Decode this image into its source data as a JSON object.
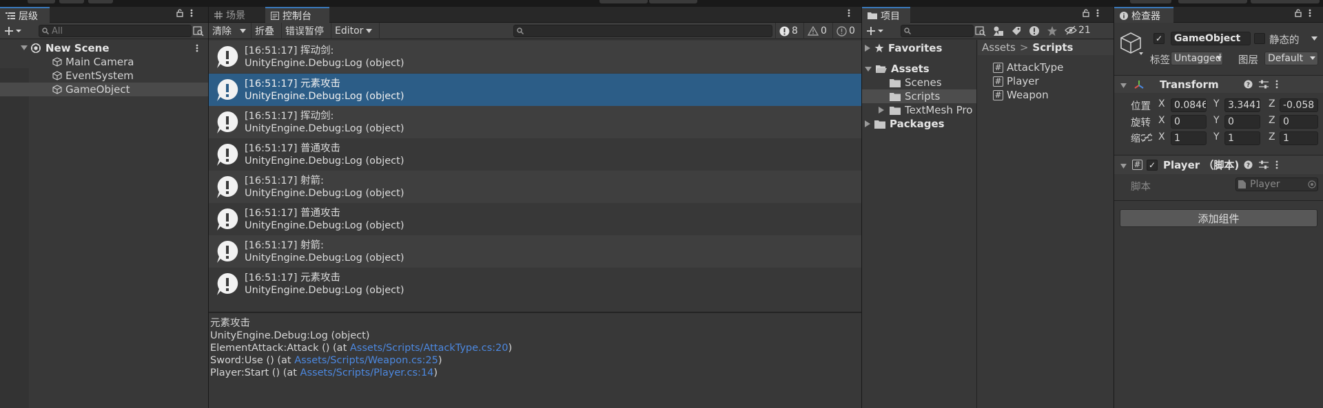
{
  "hierarchy": {
    "tab_label": "层级",
    "search_placeholder": "All",
    "scene": "New Scene",
    "items": [
      "Main Camera",
      "EventSystem",
      "GameObject"
    ]
  },
  "console": {
    "tabs": [
      "场景",
      "控制台"
    ],
    "toolbar": {
      "clear": "清除",
      "collapse": "折叠",
      "error_pause": "错误暂停",
      "editor": "Editor",
      "counts": {
        "info": "8",
        "warn": "0",
        "error": "0"
      }
    },
    "logs": [
      {
        "time": "[16:51:17] 挥动剑:",
        "trace": "UnityEngine.Debug:Log (object)"
      },
      {
        "time": "[16:51:17] 元素攻击",
        "trace": "UnityEngine.Debug:Log (object)"
      },
      {
        "time": "[16:51:17] 挥动剑:",
        "trace": "UnityEngine.Debug:Log (object)"
      },
      {
        "time": "[16:51:17] 普通攻击",
        "trace": "UnityEngine.Debug:Log (object)"
      },
      {
        "time": "[16:51:17] 射箭:",
        "trace": "UnityEngine.Debug:Log (object)"
      },
      {
        "time": "[16:51:17] 普通攻击",
        "trace": "UnityEngine.Debug:Log (object)"
      },
      {
        "time": "[16:51:17] 射箭:",
        "trace": "UnityEngine.Debug:Log (object)"
      },
      {
        "time": "[16:51:17] 元素攻击",
        "trace": "UnityEngine.Debug:Log (object)"
      }
    ],
    "detail": {
      "line1": "元素攻击",
      "line2": "UnityEngine.Debug:Log (object)",
      "line3_pre": "ElementAttack:Attack () (at ",
      "line3_link": "Assets/Scripts/AttackType.cs:20",
      "line4_pre": "Sword:Use () (at ",
      "line4_link": "Assets/Scripts/Weapon.cs:25",
      "line5_pre": "Player:Start () (at ",
      "line5_link": "Assets/Scripts/Player.cs:14",
      "close_paren": ")"
    }
  },
  "project": {
    "tab_label": "项目",
    "hidden_count": "21",
    "tree": {
      "favorites": "Favorites",
      "assets": "Assets",
      "scenes": "Scenes",
      "scripts": "Scripts",
      "textmesh": "TextMesh Pro",
      "packages": "Packages"
    },
    "breadcrumb": {
      "root": "Assets",
      "sep": ">",
      "current": "Scripts"
    },
    "files": [
      "AttackType",
      "Player",
      "Weapon"
    ]
  },
  "inspector": {
    "tab_label": "检查器",
    "object_name": "GameObject",
    "static_label": "静态的",
    "tag_label": "标签",
    "tag_value": "Untagged",
    "layer_label": "图层",
    "layer_value": "Default",
    "transform": {
      "title": "Transform",
      "position_label": "位置",
      "rotation_label": "旋转",
      "scale_label": "缩放",
      "position": {
        "x": "0.0846",
        "y": "3.3441",
        "z": "-0.058"
      },
      "rotation": {
        "x": "0",
        "y": "0",
        "z": "0"
      },
      "scale": {
        "x": "1",
        "y": "1",
        "z": "1"
      }
    },
    "script_component": {
      "title": "Player （脚本)",
      "script_label": "脚本",
      "script_value": "Player"
    },
    "add_component": "添加组件"
  },
  "colors": {
    "selection_blue": "#2c5d87",
    "link_blue": "#4c88e0",
    "active_tab_accent": "#3a79bb"
  }
}
